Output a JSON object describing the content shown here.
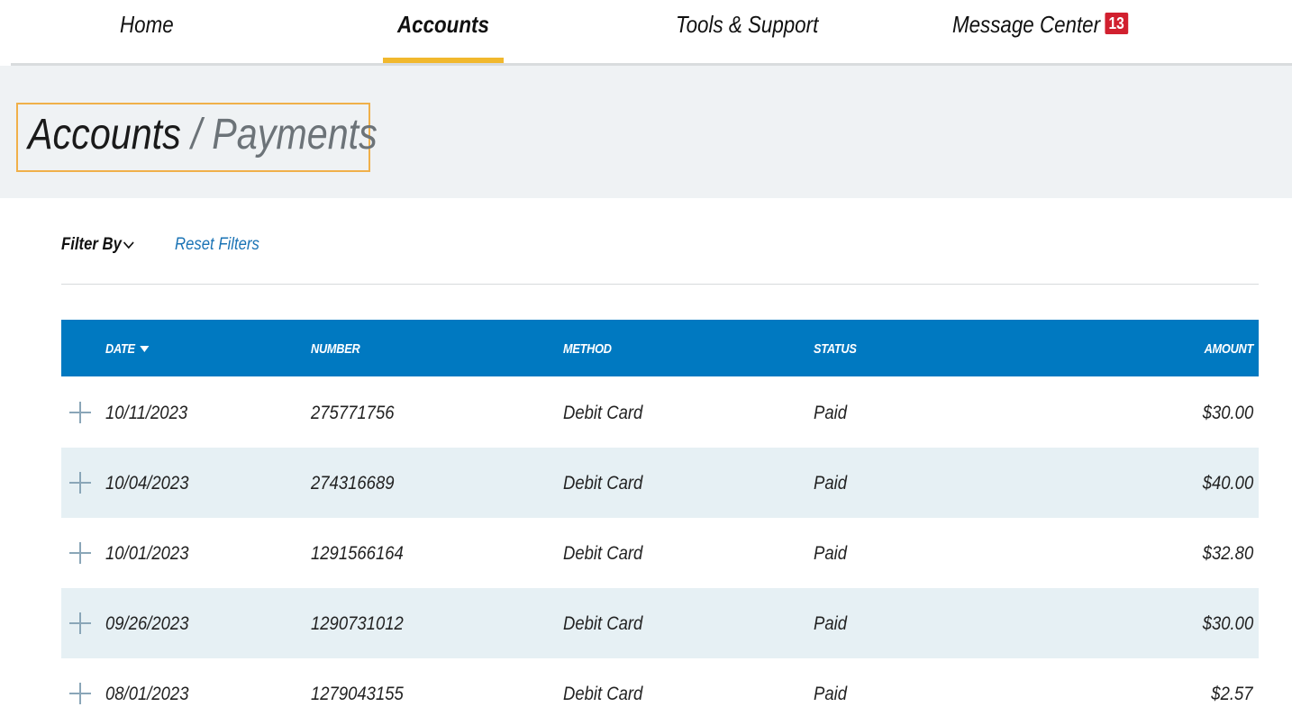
{
  "nav": {
    "items": [
      {
        "label": "Home"
      },
      {
        "label": "Accounts"
      },
      {
        "label": "Tools & Support"
      },
      {
        "label": "Message Center"
      }
    ],
    "active": "Accounts",
    "message_badge": "13"
  },
  "header": {
    "title": "Accounts",
    "separator": "/",
    "subtitle": "Payments"
  },
  "filters": {
    "filter_by_label": "Filter By",
    "reset_label": "Reset Filters"
  },
  "table": {
    "columns": {
      "date": "DATE",
      "number": "NUMBER",
      "method": "METHOD",
      "status": "STATUS",
      "amount": "AMOUNT"
    },
    "sort": {
      "column": "date",
      "direction": "descending"
    },
    "rows": [
      {
        "date": "10/11/2023",
        "number": "275771756",
        "method": "Debit Card",
        "status": "Paid",
        "amount": "$30.00"
      },
      {
        "date": "10/04/2023",
        "number": "274316689",
        "method": "Debit Card",
        "status": "Paid",
        "amount": "$40.00"
      },
      {
        "date": "10/01/2023",
        "number": "1291566164",
        "method": "Debit Card",
        "status": "Paid",
        "amount": "$32.80"
      },
      {
        "date": "09/26/2023",
        "number": "1290731012",
        "method": "Debit Card",
        "status": "Paid",
        "amount": "$30.00"
      },
      {
        "date": "08/01/2023",
        "number": "1279043155",
        "method": "Debit Card",
        "status": "Paid",
        "amount": "$2.57"
      }
    ]
  },
  "colors": {
    "accent_yellow": "#f1b82d",
    "header_blue": "#0079c1",
    "link_blue": "#1a73b5",
    "badge_red": "#d1202f",
    "row_alt": "#e6f0f4"
  },
  "icons": {
    "filter_toggle": "chevron-down-icon",
    "sort": "caret-down-icon",
    "row_expand": "plus-icon"
  }
}
